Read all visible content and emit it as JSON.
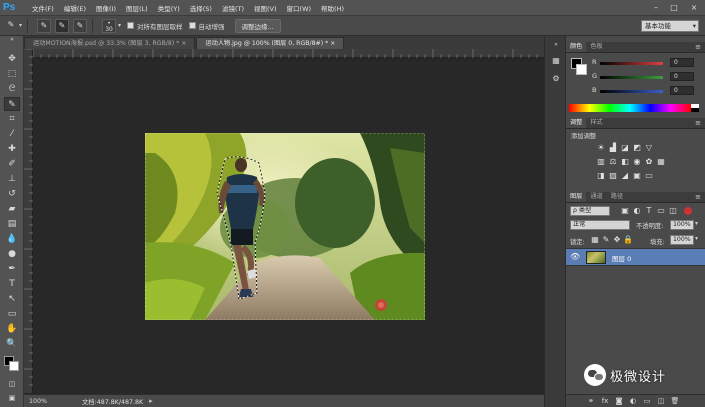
{
  "app": {
    "logo": "Ps"
  },
  "menu": [
    "文件(F)",
    "编辑(E)",
    "图像(I)",
    "图层(L)",
    "类型(Y)",
    "选择(S)",
    "滤镜(T)",
    "视图(V)",
    "窗口(W)",
    "帮助(H)"
  ],
  "options": {
    "brush_size": "30",
    "sample_all_layers": "对所有图层取样",
    "auto_enhance": "自动增强",
    "refine_edge": "调整边缘...",
    "workspace": "基本功能"
  },
  "tabs": [
    {
      "label": "运动MOTION海报.psd @ 33.3% (图层 3, RGB/8) *",
      "close": "×"
    },
    {
      "label": "运动人物.jpg @ 100% (图层 0, RGB/8#) *",
      "close": "×"
    }
  ],
  "status": {
    "zoom": "100%",
    "doc_info": "文档:487.8K/487.8K"
  },
  "color_panel": {
    "tabs": [
      "颜色",
      "色板"
    ],
    "channels": [
      {
        "label": "R",
        "value": "0",
        "color": "#e04040"
      },
      {
        "label": "G",
        "value": "0",
        "color": "#3ca03c"
      },
      {
        "label": "B",
        "value": "0",
        "color": "#3a5fd0"
      }
    ]
  },
  "adjustments_panel": {
    "tabs": [
      "调整",
      "样式"
    ],
    "title": "添加调整"
  },
  "layers_panel": {
    "tabs": [
      "图层",
      "通道",
      "路径"
    ],
    "filter_kind": "ρ 类型",
    "blend_mode": "正常",
    "opacity_label": "不透明度:",
    "opacity_value": "100%",
    "lock_label": "锁定:",
    "fill_label": "填充:",
    "fill_value": "100%",
    "layers": [
      {
        "name": "图层 0",
        "visible": true
      }
    ]
  },
  "watermark": {
    "text": "极微设计"
  }
}
